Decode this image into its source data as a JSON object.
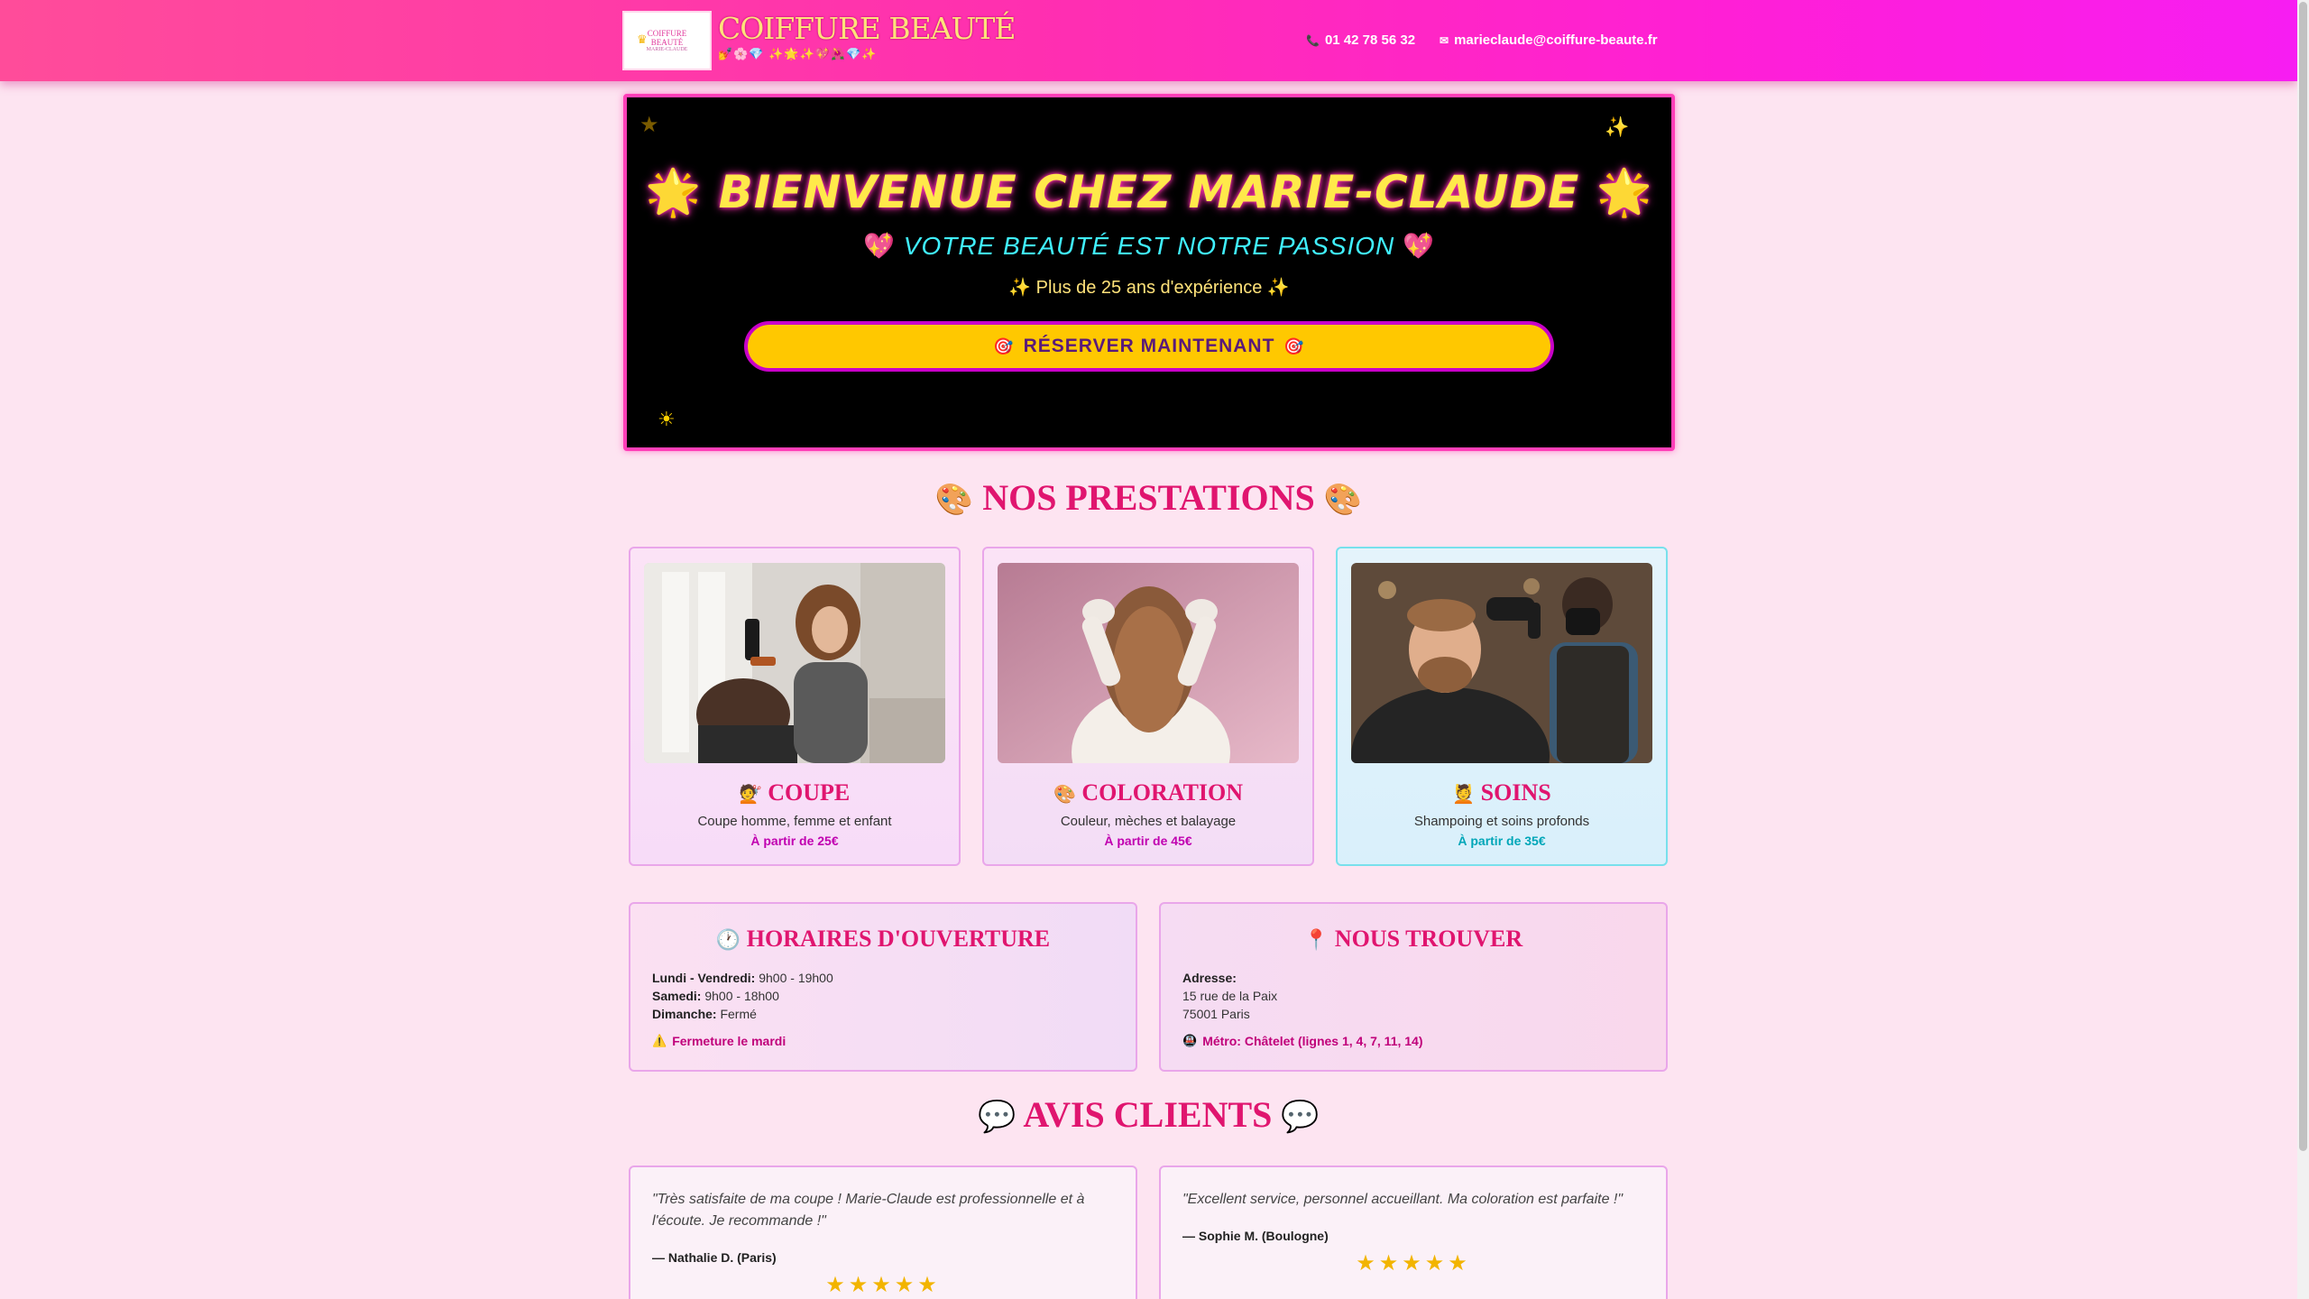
{
  "header": {
    "logo_line1": "COIFFURE",
    "logo_line2": "BEAUTÉ",
    "logo_small": "MARIE-CLAUDE",
    "brand_title": "COIFFURE BEAUTÉ",
    "brand_sub": "💅🌸💎 ✨🌟✨💖🌺💎✨",
    "phone_icon": "phone-icon",
    "phone": "01 42 78 56 32",
    "email_icon": "mail-icon",
    "email": "marieclaude@coiffure-beaute.fr"
  },
  "hero": {
    "title": "BIENVENUE CHEZ MARIE-CLAUDE",
    "subtitle": "VOTRE BEAUTÉ EST NOTRE PASSION",
    "experience": "✨ Plus de 25 ans d'expérience ✨",
    "cta_label": "RÉSERVER MAINTENANT",
    "title_icon": "🌟",
    "heart_icon": "💖",
    "target_icon": "🎯",
    "decorations": [
      "⭐",
      "✨",
      "🌟"
    ]
  },
  "services": {
    "title": "NOS PRESTATIONS",
    "title_icon": "🎨",
    "items": [
      {
        "icon": "💇",
        "name": "COUPE",
        "desc": "Coupe homme, femme et enfant",
        "price": "À partir de 25€"
      },
      {
        "icon": "🎨",
        "name": "COLORATION",
        "desc": "Couleur, mèches et balayage",
        "price": "À partir de 45€"
      },
      {
        "icon": "💆",
        "name": "SOINS",
        "desc": "Shampoing et soins profonds",
        "price": "À partir de 35€"
      }
    ]
  },
  "hours": {
    "icon": "🕐",
    "title": "HORAIRES D'OUVERTURE",
    "rows": [
      {
        "day": "Lundi - Vendredi:",
        "time": " 9h00 - 19h00"
      },
      {
        "day": "Samedi:",
        "time": " 9h00 - 18h00"
      },
      {
        "day": "Dimanche:",
        "time": " Fermé"
      }
    ],
    "warn_icon": "⚠️",
    "note": "Fermeture le mardi"
  },
  "location": {
    "icon": "📍",
    "title": "NOUS TROUVER",
    "address_label": "Adresse:",
    "address_line1": "15 rue de la Paix",
    "address_line2": "75001 Paris",
    "metro_icon": "🚇",
    "metro": "Métro: Châtelet (lignes 1, 4, 7, 11, 14)"
  },
  "reviews": {
    "title": "AVIS CLIENTS",
    "title_icon": "💬",
    "items": [
      {
        "text": "\"Très satisfaite de ma coupe ! Marie-Claude est professionnelle et à l'écoute. Je recommande !\"",
        "author": "— Nathalie D. (Paris)",
        "stars": "⭐⭐⭐⭐⭐",
        "rating": 5
      },
      {
        "text": "\"Excellent service, personnel accueillant. Ma coloration est parfaite !\"",
        "author": "— Sophie M. (Boulogne)",
        "stars": "⭐⭐⭐⭐⭐",
        "rating": 5
      }
    ]
  },
  "colors": {
    "header_start": "#ff4c9a",
    "header_end": "#f71df2",
    "accent": "#e0156f",
    "hero_bg": "#000000",
    "cta": "#ffc800",
    "page_bg": "#fde4f1"
  }
}
